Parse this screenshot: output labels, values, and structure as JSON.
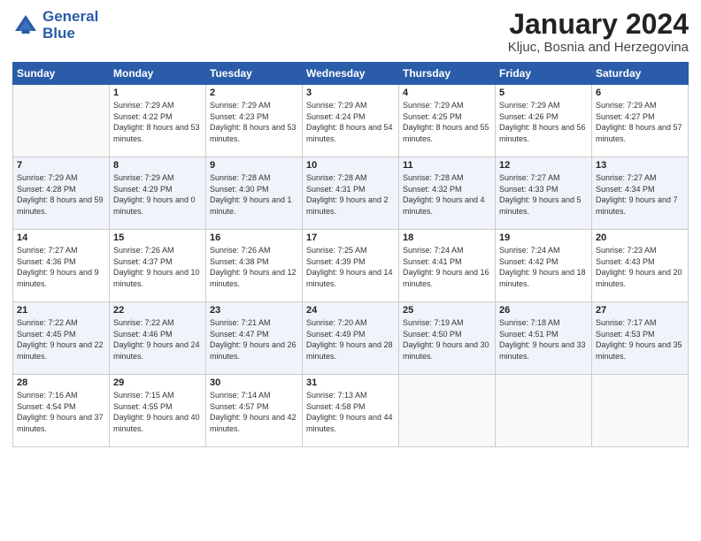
{
  "logo": {
    "line1": "General",
    "line2": "Blue"
  },
  "header": {
    "title": "January 2024",
    "location": "Kljuc, Bosnia and Herzegovina"
  },
  "weekdays": [
    "Sunday",
    "Monday",
    "Tuesday",
    "Wednesday",
    "Thursday",
    "Friday",
    "Saturday"
  ],
  "weeks": [
    [
      {
        "day": "",
        "sunrise": "",
        "sunset": "",
        "daylight": ""
      },
      {
        "day": "1",
        "sunrise": "Sunrise: 7:29 AM",
        "sunset": "Sunset: 4:22 PM",
        "daylight": "Daylight: 8 hours and 53 minutes."
      },
      {
        "day": "2",
        "sunrise": "Sunrise: 7:29 AM",
        "sunset": "Sunset: 4:23 PM",
        "daylight": "Daylight: 8 hours and 53 minutes."
      },
      {
        "day": "3",
        "sunrise": "Sunrise: 7:29 AM",
        "sunset": "Sunset: 4:24 PM",
        "daylight": "Daylight: 8 hours and 54 minutes."
      },
      {
        "day": "4",
        "sunrise": "Sunrise: 7:29 AM",
        "sunset": "Sunset: 4:25 PM",
        "daylight": "Daylight: 8 hours and 55 minutes."
      },
      {
        "day": "5",
        "sunrise": "Sunrise: 7:29 AM",
        "sunset": "Sunset: 4:26 PM",
        "daylight": "Daylight: 8 hours and 56 minutes."
      },
      {
        "day": "6",
        "sunrise": "Sunrise: 7:29 AM",
        "sunset": "Sunset: 4:27 PM",
        "daylight": "Daylight: 8 hours and 57 minutes."
      }
    ],
    [
      {
        "day": "7",
        "sunrise": "Sunrise: 7:29 AM",
        "sunset": "Sunset: 4:28 PM",
        "daylight": "Daylight: 8 hours and 59 minutes."
      },
      {
        "day": "8",
        "sunrise": "Sunrise: 7:29 AM",
        "sunset": "Sunset: 4:29 PM",
        "daylight": "Daylight: 9 hours and 0 minutes."
      },
      {
        "day": "9",
        "sunrise": "Sunrise: 7:28 AM",
        "sunset": "Sunset: 4:30 PM",
        "daylight": "Daylight: 9 hours and 1 minute."
      },
      {
        "day": "10",
        "sunrise": "Sunrise: 7:28 AM",
        "sunset": "Sunset: 4:31 PM",
        "daylight": "Daylight: 9 hours and 2 minutes."
      },
      {
        "day": "11",
        "sunrise": "Sunrise: 7:28 AM",
        "sunset": "Sunset: 4:32 PM",
        "daylight": "Daylight: 9 hours and 4 minutes."
      },
      {
        "day": "12",
        "sunrise": "Sunrise: 7:27 AM",
        "sunset": "Sunset: 4:33 PM",
        "daylight": "Daylight: 9 hours and 5 minutes."
      },
      {
        "day": "13",
        "sunrise": "Sunrise: 7:27 AM",
        "sunset": "Sunset: 4:34 PM",
        "daylight": "Daylight: 9 hours and 7 minutes."
      }
    ],
    [
      {
        "day": "14",
        "sunrise": "Sunrise: 7:27 AM",
        "sunset": "Sunset: 4:36 PM",
        "daylight": "Daylight: 9 hours and 9 minutes."
      },
      {
        "day": "15",
        "sunrise": "Sunrise: 7:26 AM",
        "sunset": "Sunset: 4:37 PM",
        "daylight": "Daylight: 9 hours and 10 minutes."
      },
      {
        "day": "16",
        "sunrise": "Sunrise: 7:26 AM",
        "sunset": "Sunset: 4:38 PM",
        "daylight": "Daylight: 9 hours and 12 minutes."
      },
      {
        "day": "17",
        "sunrise": "Sunrise: 7:25 AM",
        "sunset": "Sunset: 4:39 PM",
        "daylight": "Daylight: 9 hours and 14 minutes."
      },
      {
        "day": "18",
        "sunrise": "Sunrise: 7:24 AM",
        "sunset": "Sunset: 4:41 PM",
        "daylight": "Daylight: 9 hours and 16 minutes."
      },
      {
        "day": "19",
        "sunrise": "Sunrise: 7:24 AM",
        "sunset": "Sunset: 4:42 PM",
        "daylight": "Daylight: 9 hours and 18 minutes."
      },
      {
        "day": "20",
        "sunrise": "Sunrise: 7:23 AM",
        "sunset": "Sunset: 4:43 PM",
        "daylight": "Daylight: 9 hours and 20 minutes."
      }
    ],
    [
      {
        "day": "21",
        "sunrise": "Sunrise: 7:22 AM",
        "sunset": "Sunset: 4:45 PM",
        "daylight": "Daylight: 9 hours and 22 minutes."
      },
      {
        "day": "22",
        "sunrise": "Sunrise: 7:22 AM",
        "sunset": "Sunset: 4:46 PM",
        "daylight": "Daylight: 9 hours and 24 minutes."
      },
      {
        "day": "23",
        "sunrise": "Sunrise: 7:21 AM",
        "sunset": "Sunset: 4:47 PM",
        "daylight": "Daylight: 9 hours and 26 minutes."
      },
      {
        "day": "24",
        "sunrise": "Sunrise: 7:20 AM",
        "sunset": "Sunset: 4:49 PM",
        "daylight": "Daylight: 9 hours and 28 minutes."
      },
      {
        "day": "25",
        "sunrise": "Sunrise: 7:19 AM",
        "sunset": "Sunset: 4:50 PM",
        "daylight": "Daylight: 9 hours and 30 minutes."
      },
      {
        "day": "26",
        "sunrise": "Sunrise: 7:18 AM",
        "sunset": "Sunset: 4:51 PM",
        "daylight": "Daylight: 9 hours and 33 minutes."
      },
      {
        "day": "27",
        "sunrise": "Sunrise: 7:17 AM",
        "sunset": "Sunset: 4:53 PM",
        "daylight": "Daylight: 9 hours and 35 minutes."
      }
    ],
    [
      {
        "day": "28",
        "sunrise": "Sunrise: 7:16 AM",
        "sunset": "Sunset: 4:54 PM",
        "daylight": "Daylight: 9 hours and 37 minutes."
      },
      {
        "day": "29",
        "sunrise": "Sunrise: 7:15 AM",
        "sunset": "Sunset: 4:55 PM",
        "daylight": "Daylight: 9 hours and 40 minutes."
      },
      {
        "day": "30",
        "sunrise": "Sunrise: 7:14 AM",
        "sunset": "Sunset: 4:57 PM",
        "daylight": "Daylight: 9 hours and 42 minutes."
      },
      {
        "day": "31",
        "sunrise": "Sunrise: 7:13 AM",
        "sunset": "Sunset: 4:58 PM",
        "daylight": "Daylight: 9 hours and 44 minutes."
      },
      {
        "day": "",
        "sunrise": "",
        "sunset": "",
        "daylight": ""
      },
      {
        "day": "",
        "sunrise": "",
        "sunset": "",
        "daylight": ""
      },
      {
        "day": "",
        "sunrise": "",
        "sunset": "",
        "daylight": ""
      }
    ]
  ]
}
